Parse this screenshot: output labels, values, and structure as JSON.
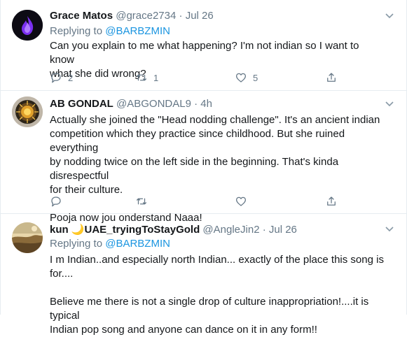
{
  "tweets": [
    {
      "name": "Grace Matos",
      "handle": "@grace2734",
      "dot": "·",
      "time": "Jul 26",
      "replying_prefix": "Replying to",
      "replying_handle": "@BARBZMIN",
      "text": "Can you explain to me what happening? I'm not indian so I want to know\nwhat she did wrong?",
      "reply_count": "2",
      "retweet_count": "1",
      "like_count": "5"
    },
    {
      "name": "AB GONDAL",
      "handle": "@ABGONDAL9",
      "dot": "·",
      "time": "4h",
      "text": "Actually she joined the \"Head nodding challenge\". It's an ancient indian\ncompetition which they practice since childhood. But she ruined everything\nby nodding twice on the left side in the beginning. That's kinda disrespectful\nfor their culture.\n\nPooja now jou onderstand Naaa!"
    },
    {
      "name": "kun 🌙UAE_tryingToStayGold",
      "handle": "@AngleJin2",
      "dot": "·",
      "time": "Jul 26",
      "replying_prefix": "Replying to",
      "replying_handle": "@BARBZMIN",
      "text": "I m Indian..and especially north Indian... exactly of the place this song is for....\n\nBelieve me there is not a single drop of culture inappropriation!....it is typical\nIndian pop song and anyone can dance on it in any form!!"
    }
  ],
  "colors": {
    "link": "#1b95e0",
    "muted": "#657786",
    "text": "#14171a",
    "border": "#e6ecf0"
  },
  "icons": [
    "reply-icon",
    "retweet-icon",
    "like-icon",
    "share-icon",
    "chevron-down-icon"
  ]
}
